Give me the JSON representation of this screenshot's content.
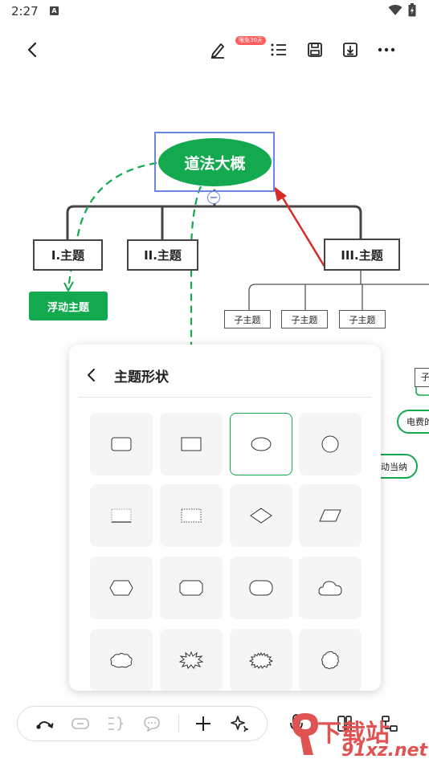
{
  "status_bar": {
    "time": "2:27",
    "badge": "A"
  },
  "toolbar": {
    "promo_badge": "限免30天"
  },
  "mindmap": {
    "root": "道法大概",
    "topics": [
      "I.主题",
      "II.主题",
      "III.主题"
    ],
    "floating_topic": "浮动主题",
    "subtopics": [
      "子主题",
      "子主题",
      "子主题"
    ],
    "partial_nodes": [
      "子",
      "电费的",
      "动当纳"
    ]
  },
  "shape_panel": {
    "title": "主题形状",
    "shapes": [
      "rounded-rect-icon",
      "rect-icon",
      "ellipse-icon",
      "circle-icon",
      "underline-rect-icon",
      "dotted-rect-icon",
      "diamond-icon",
      "parallelogram-icon",
      "hexagon-icon",
      "octagon-icon",
      "stadium-icon",
      "cloud-icon",
      "cloud-bubble-icon",
      "burst-icon",
      "spiky-burst-icon",
      "scalloped-circle-icon"
    ],
    "selected_index": 2
  },
  "bottom_bar": {
    "icons": [
      "curve-connector-icon",
      "label-icon",
      "summary-bracket-icon",
      "comment-icon",
      "add-icon",
      "ai-sparkle-icon",
      "microphone-icon",
      "layout-icon",
      "structure-icon"
    ]
  },
  "watermark": {
    "line1": "下载站",
    "line2": "91xz.net"
  },
  "colors": {
    "accent": "#13a94f",
    "selection": "#4a6bd6",
    "arrow": "#d62b2b"
  }
}
